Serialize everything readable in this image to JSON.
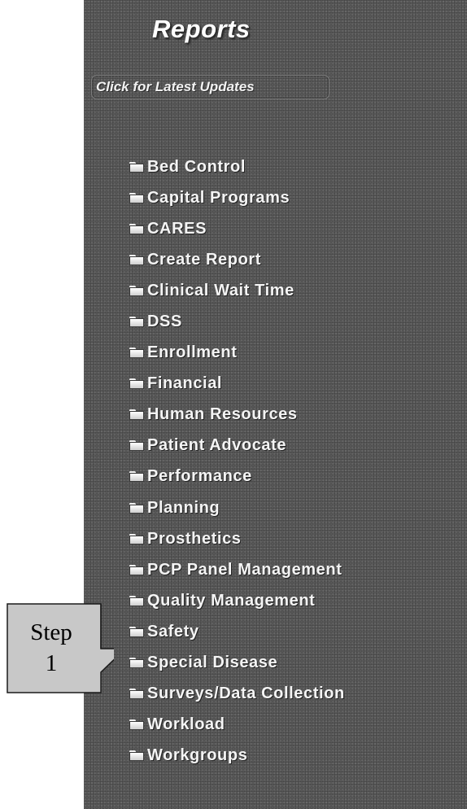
{
  "header": {
    "title": "Reports",
    "updates_link": "Click for Latest Updates"
  },
  "menu": {
    "items": [
      {
        "label": "Bed Control",
        "icon": "folder-icon"
      },
      {
        "label": "Capital Programs",
        "icon": "folder-icon"
      },
      {
        "label": "CARES",
        "icon": "folder-icon"
      },
      {
        "label": "Create Report",
        "icon": "folder-icon"
      },
      {
        "label": "Clinical Wait Time",
        "icon": "folder-icon"
      },
      {
        "label": "DSS",
        "icon": "folder-icon"
      },
      {
        "label": "Enrollment",
        "icon": "folder-icon"
      },
      {
        "label": "Financial",
        "icon": "folder-icon"
      },
      {
        "label": "Human Resources",
        "icon": "folder-icon"
      },
      {
        "label": "Patient Advocate",
        "icon": "folder-icon"
      },
      {
        "label": "Performance",
        "icon": "folder-icon"
      },
      {
        "label": "Planning",
        "icon": "folder-icon"
      },
      {
        "label": "Prosthetics",
        "icon": "folder-icon"
      },
      {
        "label": "PCP Panel Management",
        "icon": "folder-icon"
      },
      {
        "label": "Quality Management",
        "icon": "folder-icon"
      },
      {
        "label": "Safety",
        "icon": "folder-icon"
      },
      {
        "label": "Special Disease",
        "icon": "folder-icon"
      },
      {
        "label": "Surveys/Data Collection",
        "icon": "folder-icon"
      },
      {
        "label": "Workload",
        "icon": "folder-icon"
      },
      {
        "label": "Workgroups",
        "icon": "folder-icon"
      }
    ]
  },
  "callout": {
    "line1": "Step",
    "line2": "1"
  },
  "colors": {
    "panel_bg": "#5b5b5b",
    "text": "#f4f4f4",
    "callout_fill": "#c8c8c8"
  }
}
